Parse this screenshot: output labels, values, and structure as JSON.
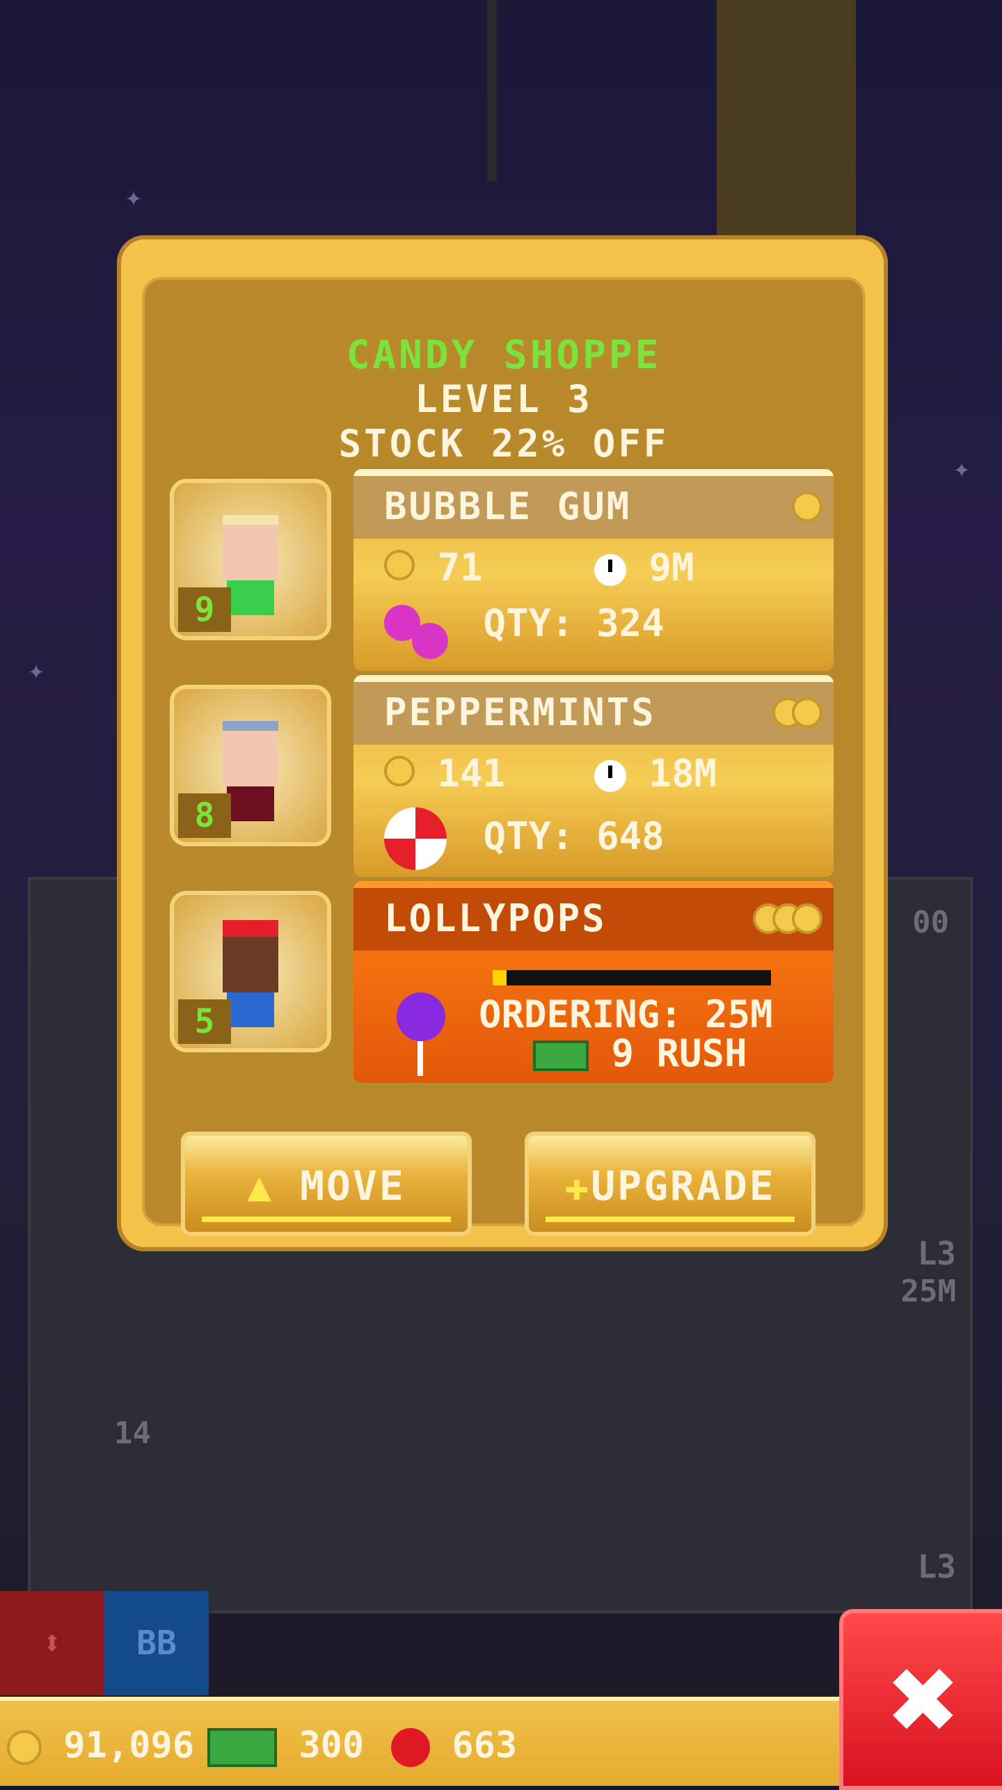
{
  "shop": {
    "name": "CANDY SHOPPE",
    "level": "LEVEL 3",
    "stock_discount": "STOCK 22% OFF"
  },
  "workers": [
    {
      "level": "9"
    },
    {
      "level": "8"
    },
    {
      "level": "5"
    }
  ],
  "products": [
    {
      "name": "BUBBLE GUM",
      "price": "71",
      "time": "9M",
      "qty": "QTY: 324",
      "tier_coins": 1
    },
    {
      "name": "PEPPERMINTS",
      "price": "141",
      "time": "18M",
      "qty": "QTY: 648",
      "tier_coins": 2
    },
    {
      "name": "LOLLYPOPS",
      "ordering": "ORDERING: 25M",
      "rush": "9 RUSH",
      "tier_coins": 3,
      "progress": 0.05
    }
  ],
  "actions": {
    "move": "MOVE",
    "upgrade": "UPGRADE"
  },
  "background": {
    "floor_number": "14",
    "elevator_button": "BB",
    "floor_labels": [
      "L3",
      "L3"
    ],
    "timer": "25M",
    "partial_label": "00"
  },
  "currency": {
    "coins": "91,096",
    "bux": "300",
    "tickets": "663"
  },
  "colors": {
    "accent_green": "#7ce33d",
    "gold": "#f5c24a",
    "orange": "#ff7f12",
    "close_red": "#e01a24"
  }
}
